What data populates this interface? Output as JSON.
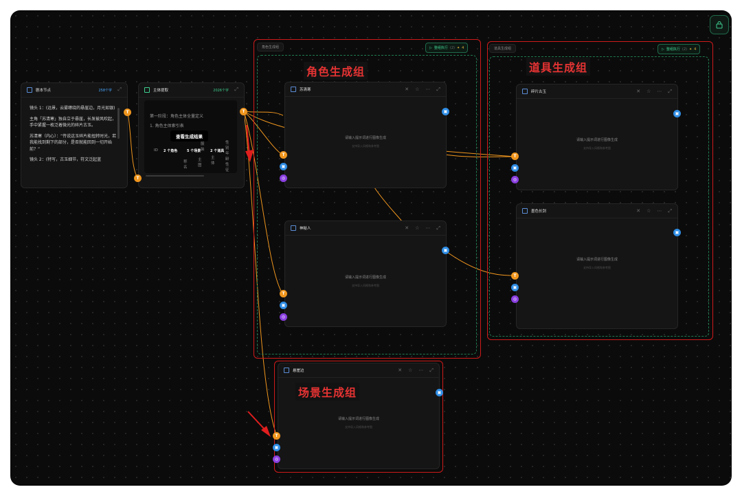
{
  "lock": {
    "icon": "lock-icon"
  },
  "script_node": {
    "title": "剧本节点",
    "wordcount": "258个字",
    "lines": [
      "镜头 1：(远景，云雾缭绕的悬崖边，月光如银)",
      "主角「苏清寒」独自立于悬崖，长发被风吹起，手中紧握一枚泛着微光的碎片古玉。",
      "苏清寒（内心）：“传说这玉碎片能扭转时光，若我能找到剩下的部分，是否就能回到一切开始前？”",
      "镜头 2：(特写，古玉细节，符文泛起蓝"
    ]
  },
  "extract_node": {
    "title": "主体提取",
    "wordcount": "2026个字",
    "line1": "第一阶段：角色主体全量定义",
    "line2": "1. 角色主体索引表",
    "tooltip": "查看生成结果",
    "id_label": "ID",
    "chips": [
      "2 个角色",
      "5 个场景",
      "2 个道具"
    ],
    "col1": "称名",
    "col2": "主图",
    "col3": "服装",
    "col4": "主体",
    "col5": "性别 年龄 性征"
  },
  "groups": {
    "role": {
      "title": "角色生成组",
      "label": "角色生成组",
      "run": "整组执行",
      "count": "(2)",
      "cost": "4"
    },
    "prop": {
      "title": "道具生成组",
      "label": "道具生成组",
      "run": "整组执行",
      "count": "(2)",
      "cost": "4"
    },
    "scene": {
      "label": "场景生成组"
    }
  },
  "image_nodes": {
    "suqinghan": {
      "title": "苏清寒",
      "placeholder": "请输入提示词进行图像生成",
      "sub": "支持导入风格和参考图"
    },
    "shenmiren": {
      "title": "神秘人",
      "placeholder": "请输入提示词进行图像生成",
      "sub": "支持导入风格和参考图"
    },
    "suipian": {
      "title": "碎片古玉",
      "placeholder": "请输入提示词进行图像生成",
      "sub": "支持导入风格和参考图"
    },
    "moseqian": {
      "title": "墨色长剑",
      "placeholder": "请输入提示词进行图像生成",
      "sub": "支持导入风格和参考图"
    },
    "xuanyabian": {
      "title": "悬崖边",
      "placeholder": "请输入提示词进行图像生成",
      "sub": "支持导入风格和参考图"
    }
  },
  "port_labels": {
    "text": "T"
  },
  "colors": {
    "accent_green": "#3ecf8e",
    "port_orange": "#f0961e",
    "port_blue": "#2f8de4",
    "port_purple": "#8a3fe0",
    "highlight_red": "#e63333",
    "wordcount_blue": "#4aa8ff"
  }
}
